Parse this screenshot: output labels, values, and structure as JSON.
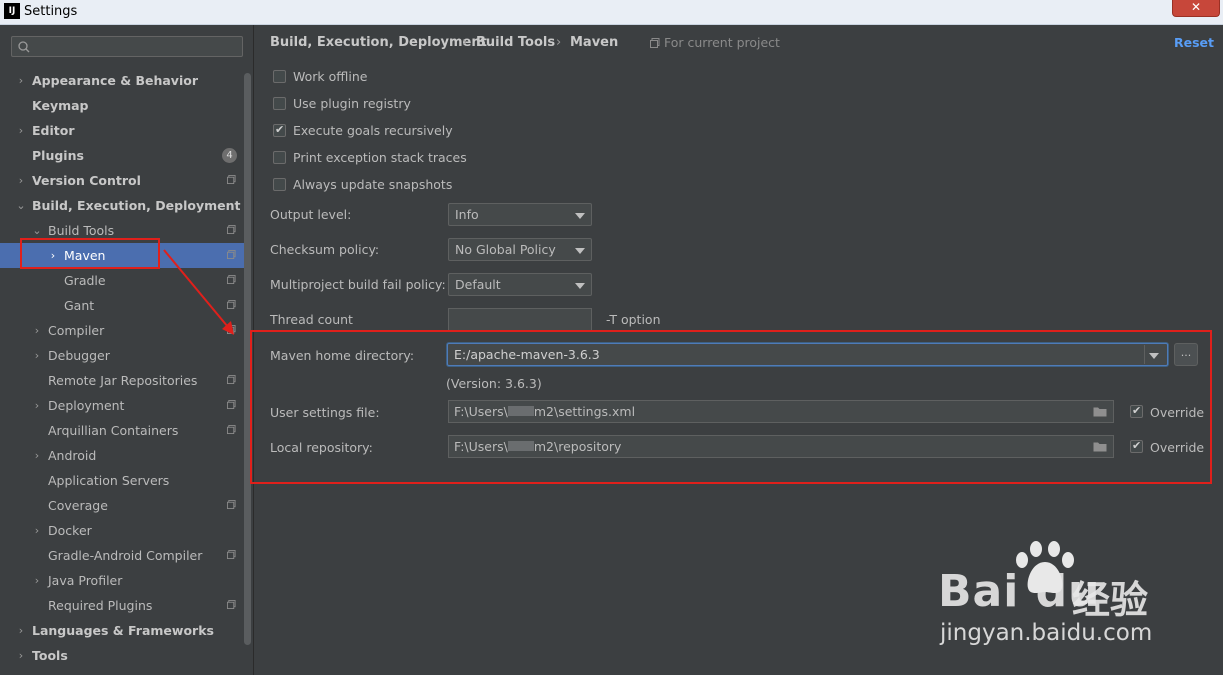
{
  "window": {
    "title": "Settings",
    "app_icon": "IJ",
    "close_label": "✕"
  },
  "sidebar": {
    "search": {
      "value": "",
      "placeholder": ""
    },
    "items": [
      {
        "label": "Appearance & Behavior",
        "level": 0,
        "arrow": "›",
        "bold": true
      },
      {
        "label": "Keymap",
        "level": 0,
        "arrow": "",
        "bold": true
      },
      {
        "label": "Editor",
        "level": 0,
        "arrow": "›",
        "bold": true
      },
      {
        "label": "Plugins",
        "level": 0,
        "arrow": "",
        "bold": true,
        "badge": "4"
      },
      {
        "label": "Version Control",
        "level": 0,
        "arrow": "›",
        "bold": true,
        "copy": true
      },
      {
        "label": "Build, Execution, Deployment",
        "level": 0,
        "arrow": "⌄",
        "bold": true
      },
      {
        "label": "Build Tools",
        "level": 1,
        "arrow": "⌄",
        "copy": true
      },
      {
        "label": "Maven",
        "level": 2,
        "arrow": "›",
        "copy": true,
        "selected": true
      },
      {
        "label": "Gradle",
        "level": 2,
        "arrow": "",
        "copy": true
      },
      {
        "label": "Gant",
        "level": 2,
        "arrow": "",
        "copy": true
      },
      {
        "label": "Compiler",
        "level": 1,
        "arrow": "›",
        "copy": true
      },
      {
        "label": "Debugger",
        "level": 1,
        "arrow": "›"
      },
      {
        "label": "Remote Jar Repositories",
        "level": 1,
        "arrow": "",
        "copy": true
      },
      {
        "label": "Deployment",
        "level": 1,
        "arrow": "›",
        "copy": true
      },
      {
        "label": "Arquillian Containers",
        "level": 1,
        "arrow": "",
        "copy": true
      },
      {
        "label": "Android",
        "level": 1,
        "arrow": "›"
      },
      {
        "label": "Application Servers",
        "level": 1,
        "arrow": ""
      },
      {
        "label": "Coverage",
        "level": 1,
        "arrow": "",
        "copy": true
      },
      {
        "label": "Docker",
        "level": 1,
        "arrow": "›"
      },
      {
        "label": "Gradle-Android Compiler",
        "level": 1,
        "arrow": "",
        "copy": true
      },
      {
        "label": "Java Profiler",
        "level": 1,
        "arrow": "›"
      },
      {
        "label": "Required Plugins",
        "level": 1,
        "arrow": "",
        "copy": true
      },
      {
        "label": "Languages & Frameworks",
        "level": 0,
        "arrow": "›",
        "bold": true
      },
      {
        "label": "Tools",
        "level": 0,
        "arrow": "›",
        "bold": true
      }
    ]
  },
  "breadcrumb": {
    "parts": [
      "Build, Execution, Deployment",
      "Build Tools",
      "Maven"
    ],
    "separator": "›",
    "hint": "For current project",
    "reset": "Reset"
  },
  "checkboxes": [
    {
      "label": "Work offline",
      "checked": false
    },
    {
      "label": "Use plugin registry",
      "checked": false
    },
    {
      "label": "Execute goals recursively",
      "checked": true
    },
    {
      "label": "Print exception stack traces",
      "checked": false
    },
    {
      "label": "Always update snapshots",
      "checked": false
    }
  ],
  "fields": {
    "output_level": {
      "label": "Output level:",
      "value": "Info"
    },
    "checksum_policy": {
      "label": "Checksum policy:",
      "value": "No Global Policy"
    },
    "fail_policy": {
      "label": "Multiproject build fail policy:",
      "value": "Default"
    },
    "thread_count": {
      "label": "Thread count",
      "value": "",
      "suffix": "-T option"
    },
    "maven_home": {
      "label": "Maven home directory:",
      "value": "E:/apache-maven-3.6.3",
      "version": "(Version: 3.6.3)",
      "browse": "..."
    },
    "user_settings": {
      "label": "User settings file:",
      "value_prefix": "F:\\Users\\",
      "value_suffix": "m2\\settings.xml",
      "override_label": "Override",
      "override": true
    },
    "local_repo": {
      "label": "Local repository:",
      "value_prefix": "F:\\Users\\",
      "value_suffix": "m2\\repository",
      "override_label": "Override",
      "override": true
    }
  },
  "watermark": {
    "brand": "Bai du",
    "cn": "经验",
    "url": "jingyan.baidu.com"
  },
  "colors": {
    "accent": "#4b6eaf",
    "annotation": "#e0201b",
    "link": "#589df6"
  }
}
